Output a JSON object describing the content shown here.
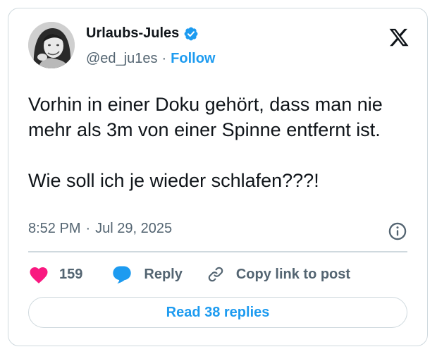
{
  "author": {
    "name": "Urlaubs-Jules",
    "handle": "@ed_ju1es",
    "separator": "·",
    "follow_label": "Follow",
    "verified_icon": "verified-badge-icon"
  },
  "tweet": {
    "text": "Vorhin in einer Doku gehört, dass man nie mehr als 3m von einer Spinne entfernt ist.\n\nWie soll ich je wieder schlafen???!",
    "time": "8:52 PM",
    "meta_separator": "·",
    "date": "Jul 29, 2025"
  },
  "actions": {
    "like_count": "159",
    "reply_label": "Reply",
    "copy_link_label": "Copy link to post"
  },
  "footer": {
    "read_replies_label": "Read 38 replies"
  },
  "colors": {
    "accent": "#1d9bf0",
    "like": "#f91880",
    "secondary_text": "#536471",
    "border": "#cfd9de"
  },
  "icons": [
    "avatar",
    "verified-badge-icon",
    "x-logo-icon",
    "info-icon",
    "heart-icon",
    "reply-bubble-icon",
    "link-icon"
  ]
}
